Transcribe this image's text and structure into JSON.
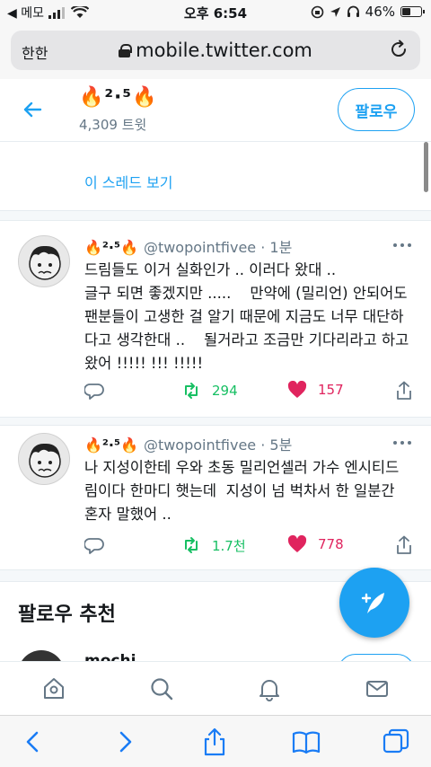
{
  "status_bar": {
    "carrier": "◀ 메모",
    "time": "오후 6:54",
    "battery": "46%",
    "battery_level": 0.46
  },
  "browser": {
    "aa_label": "한한",
    "url": "mobile.twitter.com"
  },
  "header": {
    "title": "🔥²·⁵🔥",
    "tweet_count": "4,309 트윗",
    "follow_label": "팔로우"
  },
  "thread": {
    "show_thread": "이 스레드 보기"
  },
  "tweets": [
    {
      "name": "🔥²·⁵🔥",
      "handle": "@twopointfivee",
      "time": "· 1분",
      "lines": [
        "드림들도 이거 실화인가 .. 이러다 왔대 ..",
        "글구 되면 좋겠지만 .....    만약에 (밀리언) 안되어도",
        "팬분들이 고생한 걸 알기 때문에 지금도 너무 대단하",
        "다고 생각한대 ..    될거라고 조금만 기다리라고 하고",
        "왔어 !!!!! !!! !!!!!"
      ],
      "retweets": "294",
      "likes": "157"
    },
    {
      "name": "🔥²·⁵🔥",
      "handle": "@twopointfivee",
      "time": "· 5분",
      "lines": [
        "나 지성이한테 우와 초동 밀리언셀러 가수 엔시티드",
        "림이다 한마디 햇는데  지성이 넘 벅차서 한 일분간",
        "혼자 말했어 .."
      ],
      "retweets": "1.7천",
      "likes": "778"
    }
  ],
  "recommend": {
    "title": "팔로우 추천",
    "peek_name": "mochi"
  },
  "colors": {
    "twitter_blue": "#1da1f2",
    "retweet_green": "#17bf63",
    "like_red": "#e0245e",
    "secondary_text": "#657786"
  }
}
